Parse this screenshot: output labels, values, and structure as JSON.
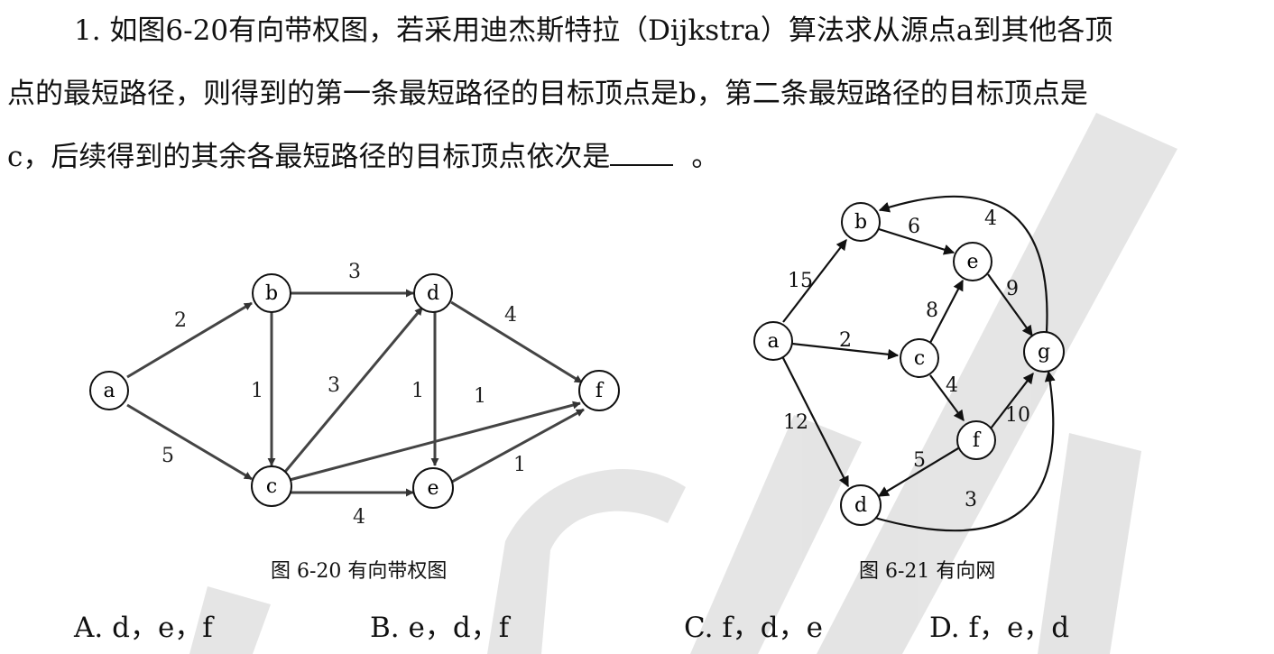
{
  "question": {
    "line1": "1. 如图6-20有向带权图，若采用迪杰斯特拉（Dijkstra）算法求从源点a到其他各顶",
    "line2": "点的最短路径，则得到的第一条最短路径的目标顶点是b，第二条最短路径的目标顶点是",
    "line3_before": "c，后续得到的其余各最短路径的目标顶点依次是",
    "line3_after": "。"
  },
  "figure_6_20": {
    "caption": "图  6-20  有向带权图",
    "nodes": [
      "a",
      "b",
      "c",
      "d",
      "e",
      "f"
    ],
    "edges": [
      {
        "from": "a",
        "to": "b",
        "weight": "2"
      },
      {
        "from": "a",
        "to": "c",
        "weight": "5"
      },
      {
        "from": "b",
        "to": "d",
        "weight": "3"
      },
      {
        "from": "b",
        "to": "c",
        "weight": "1"
      },
      {
        "from": "c",
        "to": "d",
        "weight": "3"
      },
      {
        "from": "d",
        "to": "e",
        "weight": "1"
      },
      {
        "from": "c",
        "to": "f",
        "weight": "1"
      },
      {
        "from": "d",
        "to": "f",
        "weight": "4"
      },
      {
        "from": "c",
        "to": "e",
        "weight": "4"
      },
      {
        "from": "e",
        "to": "f",
        "weight": "1"
      }
    ]
  },
  "figure_6_21": {
    "caption": "图  6-21    有向网",
    "nodes": [
      "a",
      "b",
      "c",
      "d",
      "e",
      "f",
      "g"
    ],
    "edges": [
      {
        "from": "a",
        "to": "b",
        "weight": "15"
      },
      {
        "from": "a",
        "to": "c",
        "weight": "2"
      },
      {
        "from": "a",
        "to": "d",
        "weight": "12"
      },
      {
        "from": "b",
        "to": "e",
        "weight": "6"
      },
      {
        "from": "c",
        "to": "e",
        "weight": "8"
      },
      {
        "from": "c",
        "to": "f",
        "weight": "4"
      },
      {
        "from": "e",
        "to": "g",
        "weight": "9"
      },
      {
        "from": "f",
        "to": "g",
        "weight": "10"
      },
      {
        "from": "f",
        "to": "d",
        "weight": "5"
      },
      {
        "from": "d",
        "to": "g",
        "weight": "3"
      },
      {
        "from": "g",
        "to": "b",
        "weight": "4"
      }
    ]
  },
  "options": [
    {
      "letter": "A.",
      "text": "d，e，f"
    },
    {
      "letter": "B.",
      "text": "e，d，f"
    },
    {
      "letter": "C.",
      "text": "f，d，e"
    },
    {
      "letter": "D.",
      "text": "f，e，d"
    }
  ]
}
